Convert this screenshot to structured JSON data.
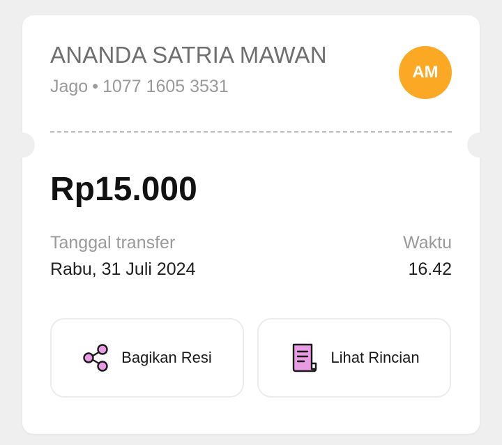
{
  "recipient": {
    "name": "ANANDA SATRIA MAWAN",
    "bank": "Jago",
    "separator": "•",
    "account_number": "1077 1605 3531",
    "initials": "AM"
  },
  "transfer": {
    "amount": "Rp15.000",
    "date_label": "Tanggal transfer",
    "date_value": "Rabu, 31 Juli 2024",
    "time_label": "Waktu",
    "time_value": "16.42"
  },
  "actions": {
    "share_label": "Bagikan Resi",
    "share_icon": "share-icon",
    "detail_label": "Lihat Rincian",
    "detail_icon": "receipt-icon"
  },
  "colors": {
    "avatar_bg": "#FBA924",
    "icon_fill": "#E79BE3",
    "icon_stroke": "#1a1a1a"
  }
}
